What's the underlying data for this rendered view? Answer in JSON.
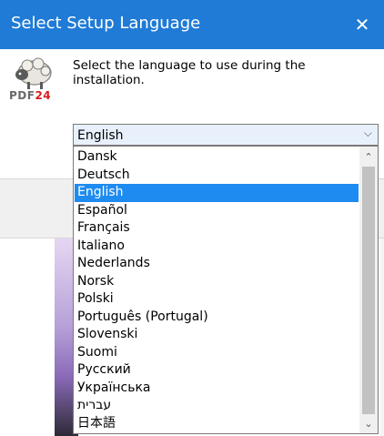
{
  "window": {
    "title": "Select Setup Language",
    "close_glyph": "✕"
  },
  "logo": {
    "text_main": "PDF",
    "text_accent": "24",
    "icon": "pdf24-sheep-logo",
    "accent_color": "#d91c1c"
  },
  "instruction": "Select the language to use during the installation.",
  "combo": {
    "value": "English",
    "arrow": "⌵"
  },
  "dropdown": {
    "items": [
      "Dansk",
      "Deutsch",
      "English",
      "Español",
      "Français",
      "Italiano",
      "Nederlands",
      "Norsk",
      "Polski",
      "Português (Portugal)",
      "Slovenski",
      "Suomi",
      "Русский",
      "Українська",
      "עברית",
      "日本語"
    ],
    "selected": "English",
    "scroll_up": "⌃",
    "scroll_down": "⌄"
  },
  "colors": {
    "titlebar": "#1f7bd6",
    "selection": "#1e8bf0",
    "combo_bg": "#e8f1fb"
  }
}
